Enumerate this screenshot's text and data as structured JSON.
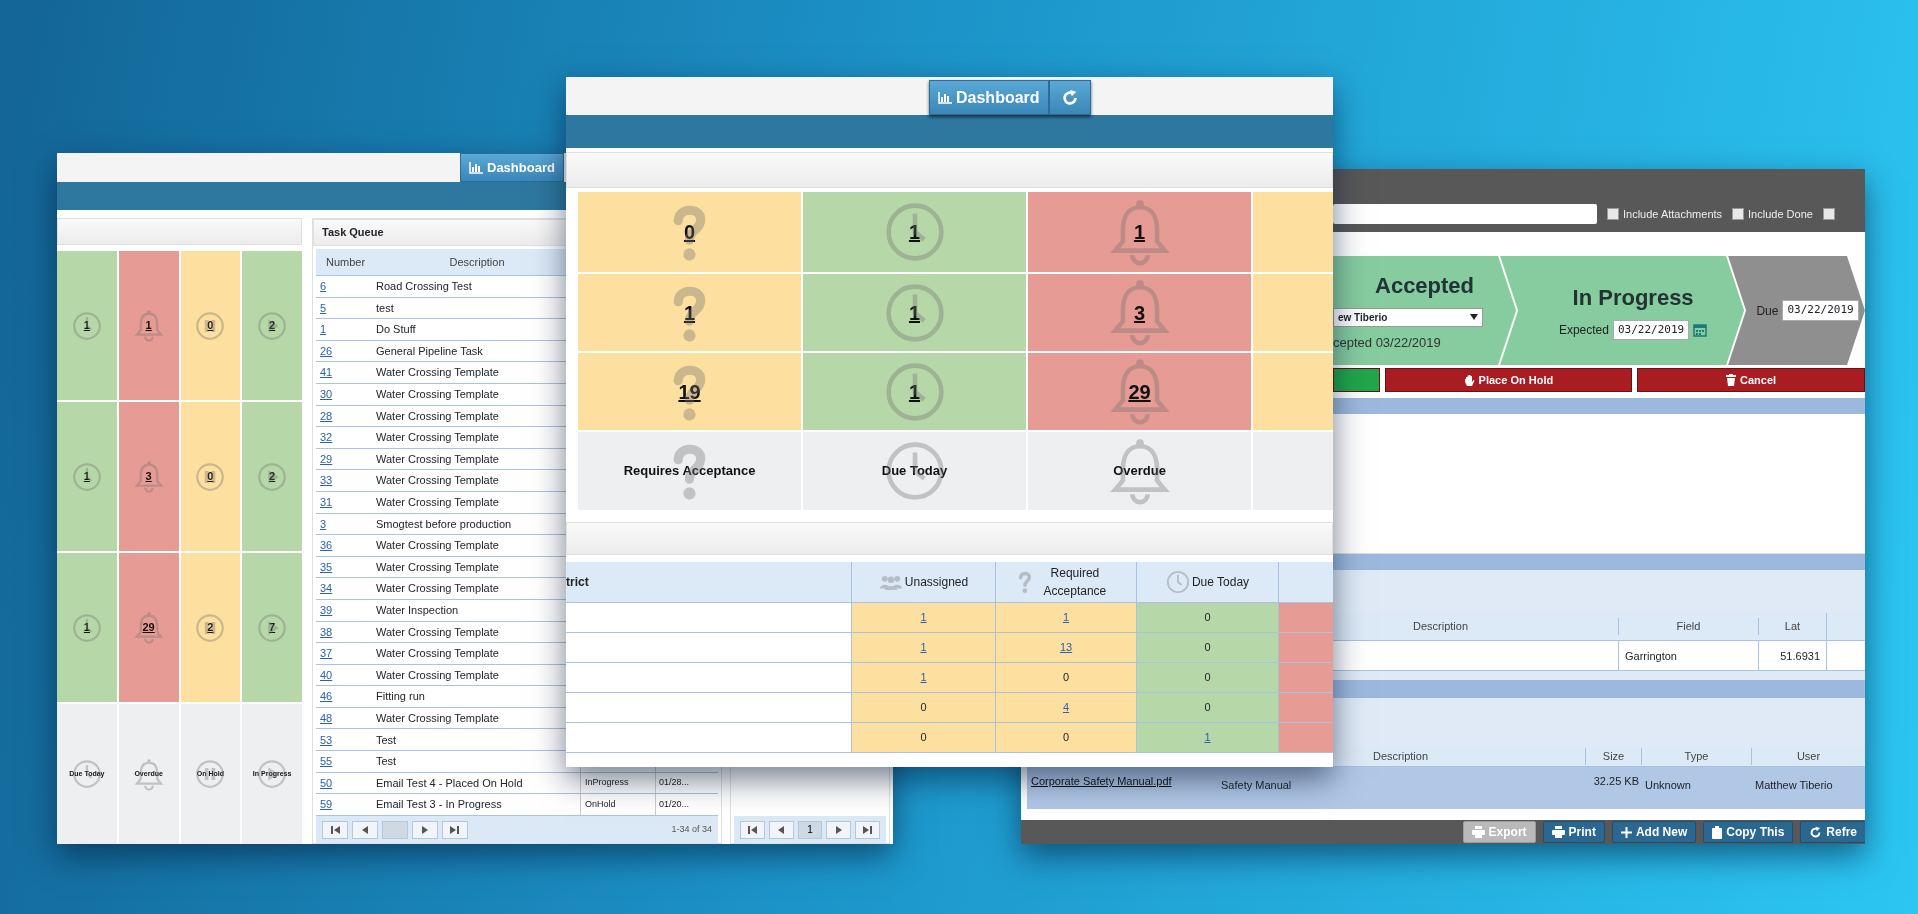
{
  "left_window": {
    "dashboard_button": "Dashboard",
    "tile_columns": [
      {
        "kind": "clock",
        "color": "#b6d8a8",
        "counts": [
          "1",
          "1",
          "1"
        ],
        "label": "Due Today"
      },
      {
        "kind": "bell",
        "color": "#e69b94",
        "counts": [
          "1",
          "3",
          "29"
        ],
        "label": "Overdue"
      },
      {
        "kind": "pause",
        "color": "#fddf9f",
        "counts": [
          "0",
          "0",
          "2"
        ],
        "label": "On Hold"
      },
      {
        "kind": "play",
        "color": "#b6d8a8",
        "counts": [
          "2",
          "2",
          "7"
        ],
        "label": "In Progress"
      }
    ],
    "task_queue": {
      "title": "Task Queue",
      "columns": [
        "Number",
        "Description"
      ],
      "rows": [
        {
          "number": "6",
          "description": "Road Crossing Test"
        },
        {
          "number": "5",
          "description": "test"
        },
        {
          "number": "1",
          "description": "Do Stuff"
        },
        {
          "number": "26",
          "description": "General Pipeline Task"
        },
        {
          "number": "41",
          "description": "Water Crossing Template"
        },
        {
          "number": "30",
          "description": "Water Crossing Template"
        },
        {
          "number": "28",
          "description": "Water Crossing Template"
        },
        {
          "number": "32",
          "description": "Water Crossing Template"
        },
        {
          "number": "29",
          "description": "Water Crossing Template"
        },
        {
          "number": "33",
          "description": "Water Crossing Template"
        },
        {
          "number": "31",
          "description": "Water Crossing Template"
        },
        {
          "number": "3",
          "description": "Smogtest before production"
        },
        {
          "number": "36",
          "description": "Water Crossing Template"
        },
        {
          "number": "35",
          "description": "Water Crossing Template"
        },
        {
          "number": "34",
          "description": "Water Crossing Template"
        },
        {
          "number": "39",
          "description": "Water Inspection"
        },
        {
          "number": "38",
          "description": "Water Crossing Template"
        },
        {
          "number": "37",
          "description": "Water Crossing Template"
        },
        {
          "number": "40",
          "description": "Water Crossing Template"
        },
        {
          "number": "46",
          "description": "Fitting run"
        },
        {
          "number": "48",
          "description": "Water Crossing Template"
        },
        {
          "number": "53",
          "description": "Test"
        },
        {
          "number": "55",
          "description": "Test"
        },
        {
          "number": "50",
          "description": "Email Test 4 - Placed On Hold",
          "status": "InProgress",
          "date": "01/28..."
        },
        {
          "number": "59",
          "description": "Email Test 3 - In Progress",
          "status": "OnHold",
          "date": "01/20..."
        }
      ],
      "pager_info": "1-34 of 34"
    },
    "side_panel": {
      "current_page": "1"
    }
  },
  "middle_window": {
    "dashboard_button": "Dashboard",
    "tile_columns": [
      {
        "kind": "question",
        "color": "#fddf9f",
        "counts": [
          "0",
          "1",
          "19"
        ],
        "label": "Requires Acceptance"
      },
      {
        "kind": "clock",
        "color": "#b6d8a8",
        "counts": [
          "1",
          "1",
          "1"
        ],
        "label": "Due Today"
      },
      {
        "kind": "bell",
        "color": "#e69b94",
        "counts": [
          "1",
          "3",
          "29"
        ],
        "label": "Overdue"
      },
      {
        "kind": "none",
        "color": "#fddf9f"
      }
    ],
    "table": {
      "columns": [
        {
          "label": "trict"
        },
        {
          "label": "Unassigned",
          "kind": "people",
          "color": "#fddf9f"
        },
        {
          "label": "Required Acceptance",
          "kind": "question",
          "color": "#fddf9f"
        },
        {
          "label": "Due Today",
          "kind": "clock",
          "color": "#b6d8a8"
        },
        {
          "kind": "none",
          "color": "#e69b94"
        }
      ],
      "rows": [
        {
          "cells": [
            "",
            {
              "text": "1",
              "link": true
            },
            {
              "text": "1",
              "link": true
            },
            {
              "text": "0",
              "link": false
            }
          ]
        },
        {
          "cells": [
            "",
            {
              "text": "1",
              "link": true
            },
            {
              "text": "13",
              "link": true
            },
            {
              "text": "0",
              "link": false
            }
          ]
        },
        {
          "cells": [
            "",
            {
              "text": "1",
              "link": true
            },
            {
              "text": "0",
              "link": false
            },
            {
              "text": "0",
              "link": false
            }
          ]
        },
        {
          "cells": [
            "",
            {
              "text": "0",
              "link": false
            },
            {
              "text": "4",
              "link": true
            },
            {
              "text": "0",
              "link": false
            }
          ]
        },
        {
          "cells": [
            "",
            {
              "text": "0",
              "link": false
            },
            {
              "text": "0",
              "link": false
            },
            {
              "text": "1",
              "link": true
            }
          ]
        }
      ]
    }
  },
  "right_window": {
    "search": {
      "checkboxes": [
        {
          "label": "Include Attachments",
          "checked": false
        },
        {
          "label": "Include Done",
          "checked": false
        },
        {
          "checked": false
        }
      ]
    },
    "steps": [
      {
        "kind": "accepted",
        "title": "Accepted",
        "assignee": "ew Tiberio",
        "note": "cepted 03/22/2019"
      },
      {
        "kind": "progress",
        "title": "In Progress",
        "field_label": "Expected",
        "date": "03/22/2019"
      },
      {
        "kind": "due",
        "field_label": "Due",
        "date": "03/22/2019"
      }
    ],
    "actions": [
      {
        "kind": "complete"
      },
      {
        "kind": "hold",
        "label": "Place On Hold"
      },
      {
        "kind": "cancel",
        "label": "Cancel"
      }
    ],
    "locations": {
      "columns": [
        "Description",
        "Field",
        "Lat"
      ],
      "rows": [
        {
          "field": "Garrington",
          "lat": "51.6931"
        }
      ]
    },
    "attachments": {
      "columns": [
        "Description",
        "Size",
        "Type",
        "User"
      ],
      "rows": [
        {
          "file": "Corporate Safety Manual.pdf",
          "description": "Safety Manual",
          "size": "32.25 KB",
          "type": "Unknown",
          "user": "Matthew Tiberio"
        }
      ]
    },
    "toolbar": [
      {
        "kind": "export",
        "label": "Export",
        "disabled": true
      },
      {
        "kind": "print",
        "label": "Print",
        "disabled": false
      },
      {
        "kind": "add",
        "label": "Add New",
        "disabled": false
      },
      {
        "kind": "copy",
        "label": "Copy This",
        "disabled": false
      },
      {
        "kind": "refresh",
        "label": "Refre",
        "disabled": false
      }
    ]
  }
}
